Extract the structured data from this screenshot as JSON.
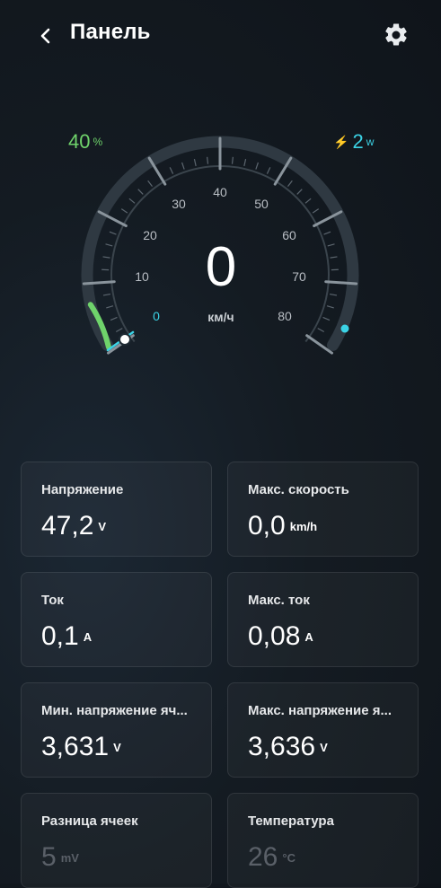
{
  "header": {
    "title": "Панель"
  },
  "gauge": {
    "battery_percent": "40",
    "battery_unit": "%",
    "power_value": "2",
    "power_unit": "w",
    "speed": "0",
    "speed_unit": "км/ч",
    "ticks": [
      "0",
      "10",
      "20",
      "30",
      "40",
      "50",
      "60",
      "70",
      "80"
    ],
    "battery_level": 0.4,
    "colors": {
      "battery": "#6fd36b",
      "power": "#3bd3e6"
    }
  },
  "stats": [
    {
      "label": "Напряжение",
      "value": "47,2",
      "unit": "V"
    },
    {
      "label": "Макс. скорость",
      "value": "0,0",
      "unit": "km/h"
    },
    {
      "label": "Ток",
      "value": "0,1",
      "unit": "A"
    },
    {
      "label": "Макс. ток",
      "value": "0,08",
      "unit": "A"
    },
    {
      "label": "Мин. напряжение яч...",
      "value": "3,631",
      "unit": "V"
    },
    {
      "label": "Макс. напряжение я...",
      "value": "3,636",
      "unit": "V"
    },
    {
      "label": "Разница ячеек",
      "value": "5",
      "unit": "mV"
    },
    {
      "label": "Температура",
      "value": "26",
      "unit": "°C"
    }
  ]
}
